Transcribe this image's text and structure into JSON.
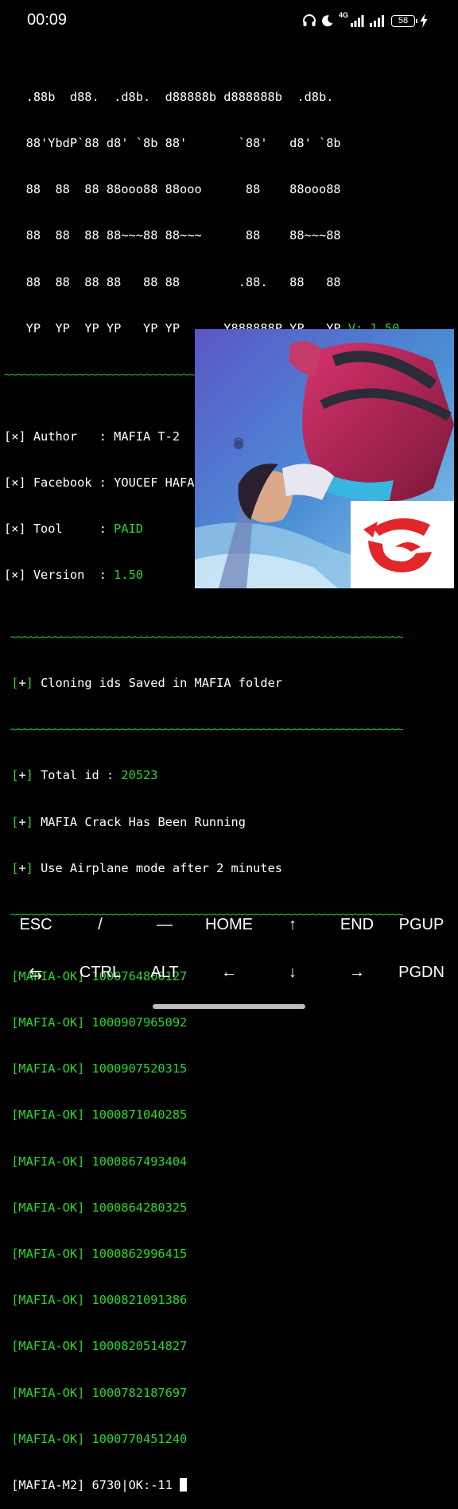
{
  "status_bar": {
    "time": "00:09",
    "network_label": "4G",
    "battery": "58"
  },
  "terminal": {
    "banner": [
      "   .88b  d88.  .d8b.  d88888b d888888b  .d8b.",
      "   88'YbdP`88 d8' `8b 88'       `88'   d8' `8b",
      "   88  88  88 88ooo88 88ooo      88    88ooo88",
      "   88  88  88 88~~~88 88~~~      88    88~~~88",
      "   88  88  88 88   88 88        .88.   88   88",
      "   YP  YP  YP YP   YP YP      Y888888P YP   YP "
    ],
    "version_tag": "V: 1.50",
    "separator": "~~~~~~~~~~~~~~~~~~~~~~~~~~~~~~~~~~~~~~~~~~~~~~~~~~~~~~~~~~~~~~~~",
    "info": [
      {
        "label": "[×] Author   : ",
        "value": "MAFIA T-2",
        "value_color": "#ffffff"
      },
      {
        "label": "[×] Facebook : ",
        "value": "YOUCEF HAFAFNI",
        "value_color": "#ffffff"
      },
      {
        "label": "[×] Tool     : ",
        "value": "PAID",
        "value_color": "#2ad82a"
      },
      {
        "label": "[×] Version  : ",
        "value": "1.50",
        "value_color": "#2ad82a"
      }
    ],
    "notice_saved": "Cloning ids Saved in MAFIA folder",
    "total_label": "Total id : ",
    "total_value": "20523",
    "notice_running": "MAFIA Crack Has Been Running",
    "notice_airplane": "Use Airplane mode after 2 minutes",
    "ok_prefix": "[MAFIA-OK] ",
    "ok_ids": [
      "1000764800127",
      "1000907965092",
      "1000907520315",
      "1000871040285",
      "1000867493404",
      "1000864280325",
      "1000862996415",
      "1000821091386",
      "1000820514827",
      "1000782187697",
      "1000770451240"
    ],
    "progress_line": "[MAFIA-M2] 6730|OK:-11 "
  },
  "extra_keys": {
    "row1": [
      "ESC",
      "/",
      "—",
      "HOME",
      "↑",
      "END",
      "PGUP"
    ],
    "row2": [
      "⇆",
      "CTRL",
      "ALT",
      "←",
      "↓",
      "→",
      "PGDN"
    ]
  },
  "colors": {
    "terminal_bg": "#000000",
    "green": "#2ad82a",
    "separator_green": "#22b522",
    "text": "#ffffff"
  }
}
